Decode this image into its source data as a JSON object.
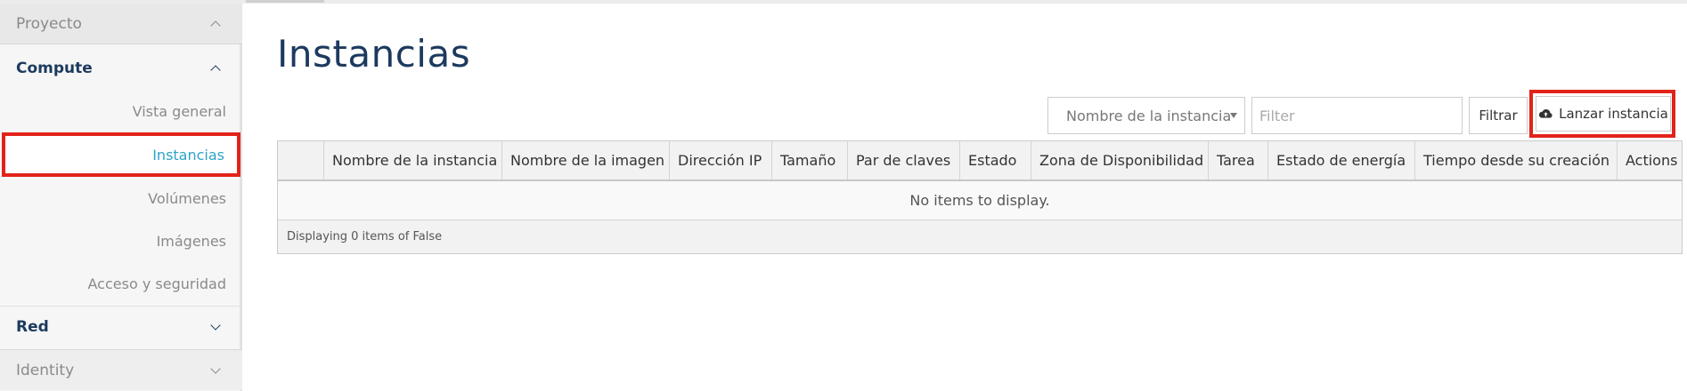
{
  "sidebar": {
    "project": {
      "label": "Proyecto",
      "state": "expanded"
    },
    "compute": {
      "label": "Compute",
      "state": "expanded"
    },
    "items": [
      {
        "label": "Vista general",
        "active": false
      },
      {
        "label": "Instancias",
        "active": true
      },
      {
        "label": "Volúmenes",
        "active": false
      },
      {
        "label": "Imágenes",
        "active": false
      },
      {
        "label": "Acceso y seguridad",
        "active": false
      }
    ],
    "red": {
      "label": "Red",
      "state": "collapsed"
    },
    "identity": {
      "label": "Identity",
      "state": "collapsed"
    }
  },
  "page": {
    "title": "Instancias"
  },
  "toolbar": {
    "filter_field": "Nombre de la instancia",
    "filter_placeholder": "Filter",
    "filter_value": "",
    "filter_button": "Filtrar",
    "launch_button": "Lanzar instancia",
    "launch_icon": "cloud-upload-icon"
  },
  "table": {
    "columns": [
      "",
      "Nombre de la instancia",
      "Nombre de la imagen",
      "Dirección IP",
      "Tamaño",
      "Par de claves",
      "Estado",
      "Zona de Disponibilidad",
      "Tarea",
      "Estado de energía",
      "Tiempo desde su creación",
      "Actions"
    ],
    "rows": [],
    "empty_message": "No items to display.",
    "footer": "Displaying 0 items of False"
  },
  "colors": {
    "title": "#1c3a5e",
    "active_link": "#2ea3c9",
    "highlight": "#e2231a",
    "sidebar_bg": "#f6f6f6"
  }
}
